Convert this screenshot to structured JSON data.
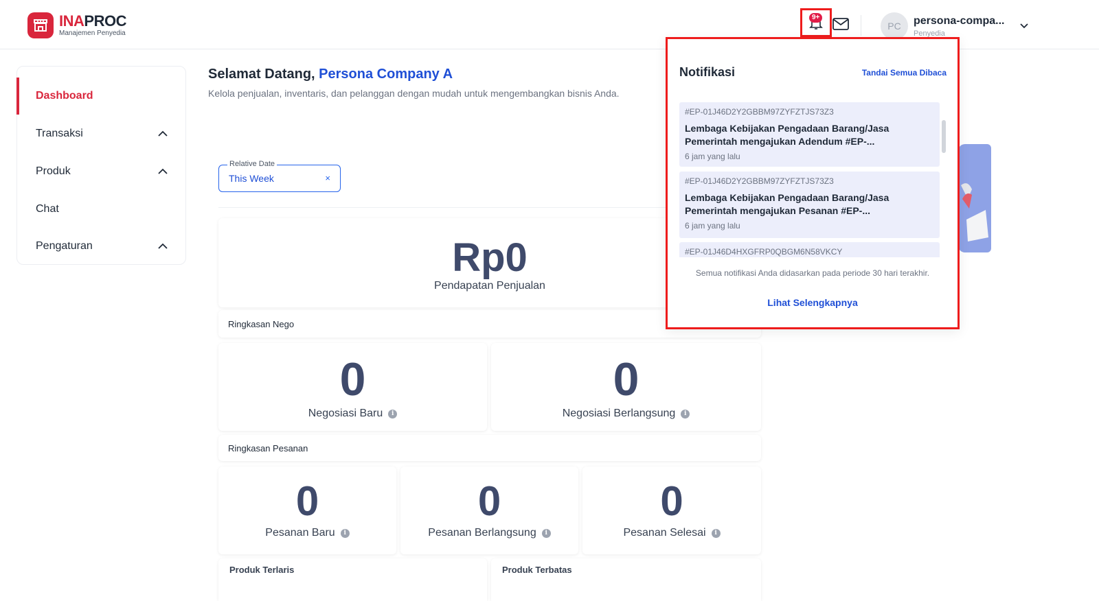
{
  "header": {
    "brand_part1": "INA",
    "brand_part2": "PROC",
    "brand_sub": "Manajemen Penyedia",
    "notification_badge": "9+",
    "avatar_initials": "PC",
    "user_name": "persona-compa...",
    "user_role": "Penyedia"
  },
  "sidebar": {
    "items": [
      {
        "label": "Dashboard",
        "active": true,
        "has_chevron": false
      },
      {
        "label": "Transaksi",
        "active": false,
        "has_chevron": true
      },
      {
        "label": "Produk",
        "active": false,
        "has_chevron": true
      },
      {
        "label": "Chat",
        "active": false,
        "has_chevron": false
      },
      {
        "label": "Pengaturan",
        "active": false,
        "has_chevron": true
      }
    ]
  },
  "main": {
    "welcome_prefix": "Selamat Datang,",
    "company": "Persona Company A",
    "subtitle": "Kelola penjualan, inventaris, dan pelanggan dengan mudah untuk mengembangkan bisnis Anda.",
    "date_filter": {
      "label": "Relative Date",
      "value": "This Week",
      "clear": "×"
    },
    "revenue": {
      "value": "Rp0",
      "label": "Pendapatan Penjualan"
    },
    "nego_section": "Ringkasan Nego",
    "nego": [
      {
        "value": "0",
        "label": "Negosiasi Baru"
      },
      {
        "value": "0",
        "label": "Negosiasi Berlangsung"
      }
    ],
    "order_section": "Ringkasan Pesanan",
    "orders": [
      {
        "value": "0",
        "label": "Pesanan Baru"
      },
      {
        "value": "0",
        "label": "Pesanan Berlangsung"
      },
      {
        "value": "0",
        "label": "Pesanan Selesai"
      }
    ],
    "bottom_sections": [
      "Produk Terlaris",
      "Produk Terbatas"
    ]
  },
  "notifications": {
    "title": "Notifikasi",
    "mark_all": "Tandai Semua Dibaca",
    "items": [
      {
        "id": "#EP-01J46D2Y2GBBM97ZYFZTJS73Z3",
        "message": "Lembaga Kebijakan Pengadaan Barang/Jasa Pemerintah mengajukan Adendum #EP-...",
        "time": "6 jam yang lalu"
      },
      {
        "id": "#EP-01J46D2Y2GBBM97ZYFZTJS73Z3",
        "message": "Lembaga Kebijakan Pengadaan Barang/Jasa Pemerintah mengajukan Pesanan #EP-...",
        "time": "6 jam yang lalu"
      },
      {
        "id": "#EP-01J46D4HXGFRP0QBGM6N58VKCY",
        "message": "",
        "time": ""
      }
    ],
    "footer_note": "Semua notifikasi Anda didasarkan pada periode 30 hari terakhir.",
    "see_more": "Lihat Selengkapnya"
  },
  "colors": {
    "brand_red": "#d9263c",
    "link_blue": "#1f4fd6",
    "number_slate": "#3f4a6b",
    "highlight_red": "#ee1c1c"
  }
}
